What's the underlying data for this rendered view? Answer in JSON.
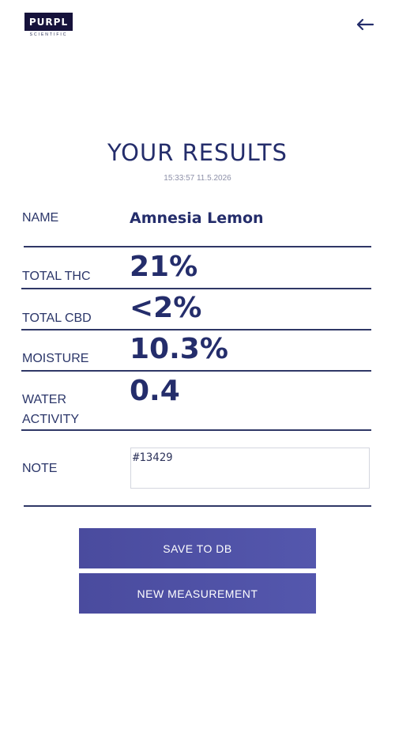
{
  "header": {
    "logo_text": "PURPL",
    "logo_sub": "SCIENTIFIC",
    "back_icon": "arrow-left-icon"
  },
  "results": {
    "title": "YOUR RESULTS",
    "timestamp": "15:33:57 11.5.2026",
    "rows": [
      {
        "label": "NAME",
        "value": "Amnesia Lemon"
      },
      {
        "label": "TOTAL THC",
        "value": "21%"
      },
      {
        "label": "TOTAL CBD",
        "value": "<2%"
      },
      {
        "label": "MOISTURE",
        "value": "10.3%"
      },
      {
        "label_line1": "WATER",
        "label_line2": "ACTIVITY",
        "value": "0.4"
      }
    ],
    "note": {
      "label": "NOTE",
      "value": "#13429"
    }
  },
  "actions": {
    "save_label": "SAVE TO DB",
    "new_label": "NEW MEASUREMENT"
  },
  "colors": {
    "primary_text": "#242d6b",
    "button": "#4f51a6",
    "logo_bg": "#16123b"
  }
}
